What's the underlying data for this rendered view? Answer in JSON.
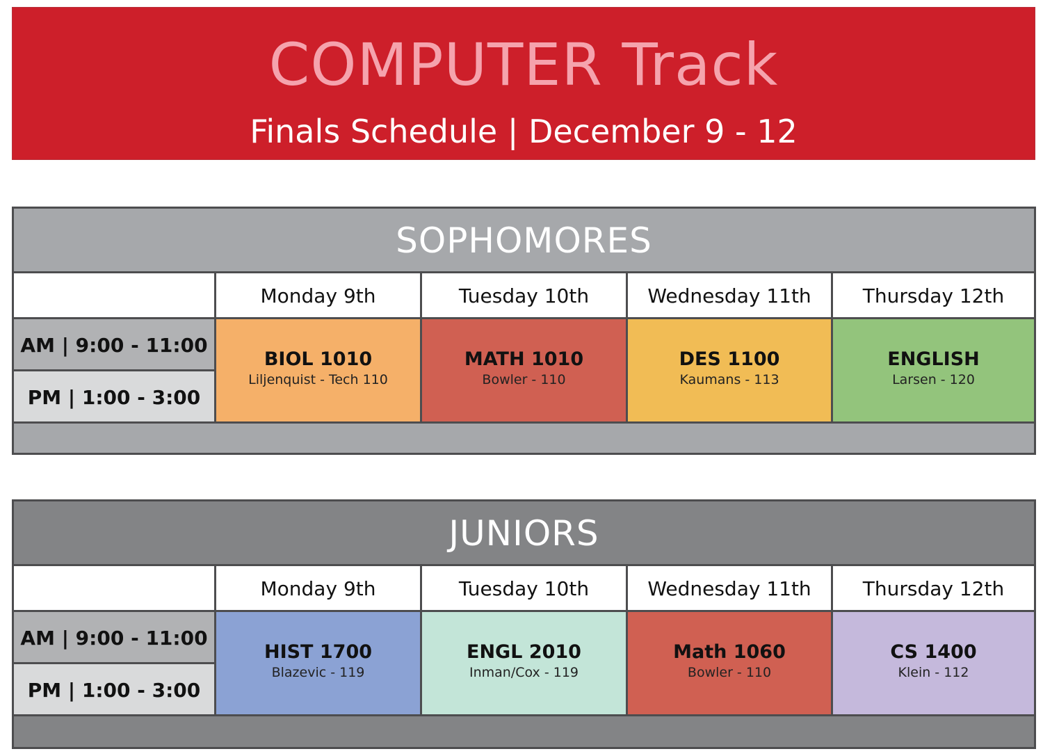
{
  "header": {
    "title": "COMPUTER Track",
    "subtitle": "Finals Schedule | December 9 - 12"
  },
  "colors": {
    "banner": "#cd1f2a",
    "title_text": "#f5a3ad",
    "sophomores_band": "#a6a8ab",
    "juniors_band": "#838486"
  },
  "sections": [
    {
      "title": "SOPHOMORES",
      "days": [
        "Monday 9th",
        "Tuesday 10th",
        "Wednesday 11th",
        "Thursday 12th"
      ],
      "times": [
        "AM | 9:00 - 11:00",
        "PM | 1:00 - 3:00"
      ],
      "courses": [
        {
          "code": "BIOL 1010",
          "instructor": "Liljenquist - Tech 110",
          "color": "#f5b069"
        },
        {
          "code": "MATH 1010",
          "instructor": "Bowler - 110",
          "color": "#d06052"
        },
        {
          "code": "DES 1100",
          "instructor": "Kaumans - 113",
          "color": "#f1bc55"
        },
        {
          "code": "ENGLISH",
          "instructor": "Larsen - 120",
          "color": "#93c47c"
        }
      ]
    },
    {
      "title": "JUNIORS",
      "days": [
        "Monday 9th",
        "Tuesday 10th",
        "Wednesday 11th",
        "Thursday 12th"
      ],
      "times": [
        "AM | 9:00 - 11:00",
        "PM | 1:00 - 3:00"
      ],
      "courses": [
        {
          "code": "HIST 1700",
          "instructor": "Blazevic - 119",
          "color": "#8ba2d4"
        },
        {
          "code": "ENGL 2010",
          "instructor": "Inman/Cox - 119",
          "color": "#c3e5d8"
        },
        {
          "code": "Math 1060",
          "instructor": "Bowler - 110",
          "color": "#d06052"
        },
        {
          "code": "CS 1400",
          "instructor": "Klein - 112",
          "color": "#c5b9dc"
        }
      ]
    }
  ]
}
